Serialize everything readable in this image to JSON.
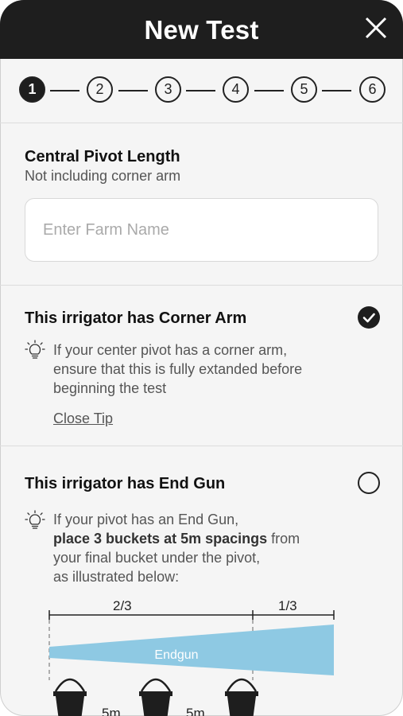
{
  "header": {
    "title": "New Test"
  },
  "stepper": {
    "steps": [
      "1",
      "2",
      "3",
      "4",
      "5",
      "6"
    ],
    "active": 1
  },
  "pivot": {
    "title": "Central Pivot Length",
    "subtitle": "Not including corner arm",
    "input": {
      "placeholder": "Enter Farm Name",
      "value": ""
    }
  },
  "corner_arm": {
    "title": "This irrigator has Corner Arm",
    "checked": true,
    "tip_lines": [
      "If your center pivot has a corner arm,",
      "ensure that this is fully extanded before",
      "beginning the test"
    ],
    "close_tip": "Close Tip"
  },
  "end_gun": {
    "title": "This irrigator has End Gun",
    "checked": false,
    "tip_line1": "If your pivot has an End Gun,",
    "tip_bold": "place 3 buckets at 5m spacings",
    "tip_after_bold": " from",
    "tip_line3": "your final bucket under the pivot,",
    "tip_line4": "as illustrated below:"
  },
  "illustration": {
    "left_fraction": "2/3",
    "right_fraction": "1/3",
    "beam_label": "Endgun",
    "spacing_labels": [
      "5m",
      "5m"
    ],
    "beam_color": "#8ec9e3",
    "bucket_color": "#1e1e1e"
  }
}
